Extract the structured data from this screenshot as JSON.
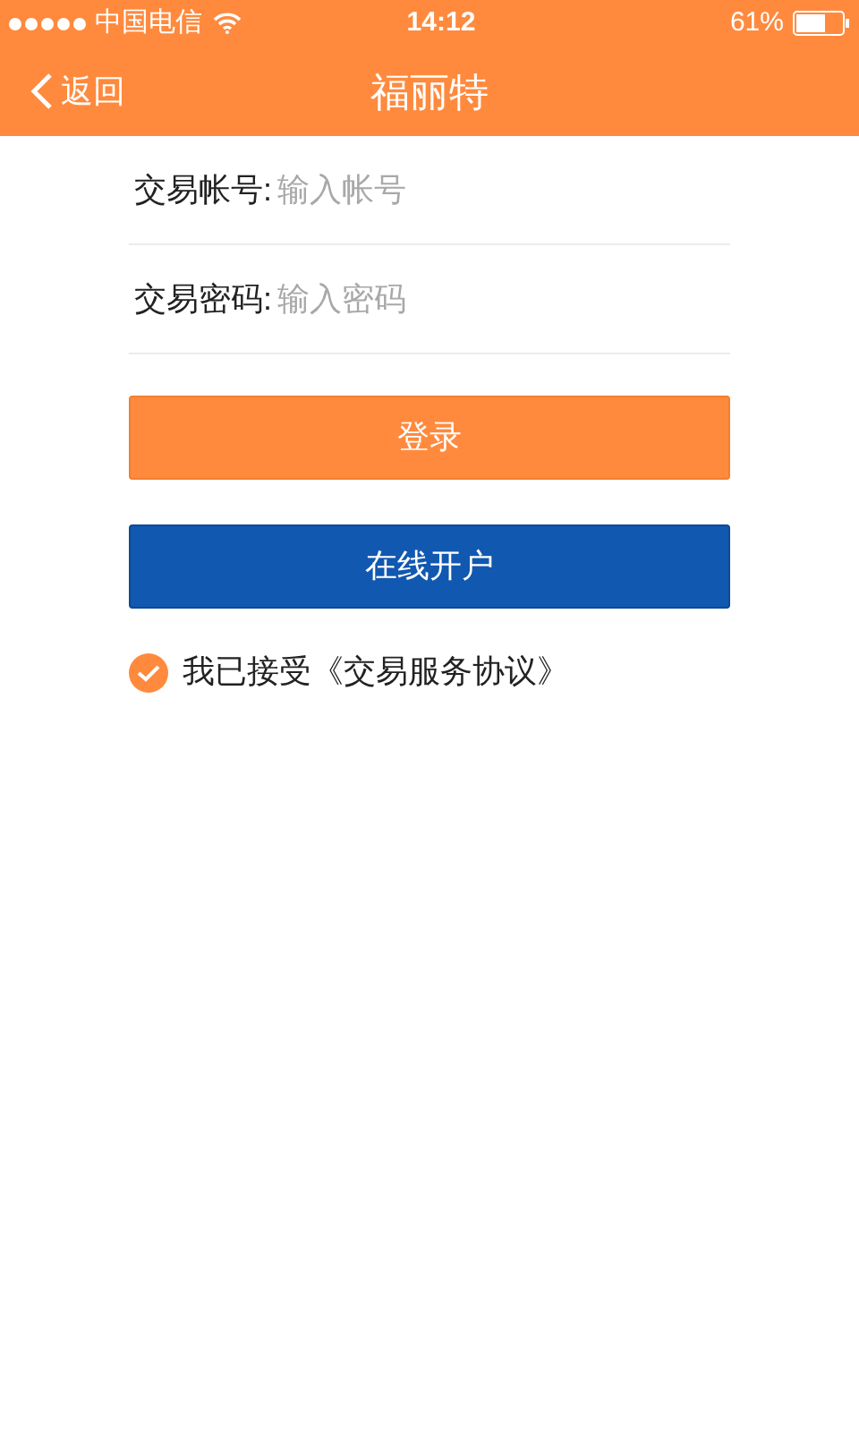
{
  "status_bar": {
    "carrier": "中国电信",
    "time": "14:12",
    "battery": "61%"
  },
  "nav": {
    "back": "返回",
    "title": "福丽特"
  },
  "fields": [
    {
      "label": "交易帐号:",
      "placeholder": "输入帐号"
    },
    {
      "label": "交易密码:",
      "placeholder": "输入密码"
    }
  ],
  "buttons": [
    {
      "label": "登录",
      "kind": "primary"
    },
    {
      "label": "在线开户",
      "kind": "secondary"
    }
  ],
  "agreement": {
    "checked": true,
    "text": "我已接受《交易服务协议》"
  }
}
